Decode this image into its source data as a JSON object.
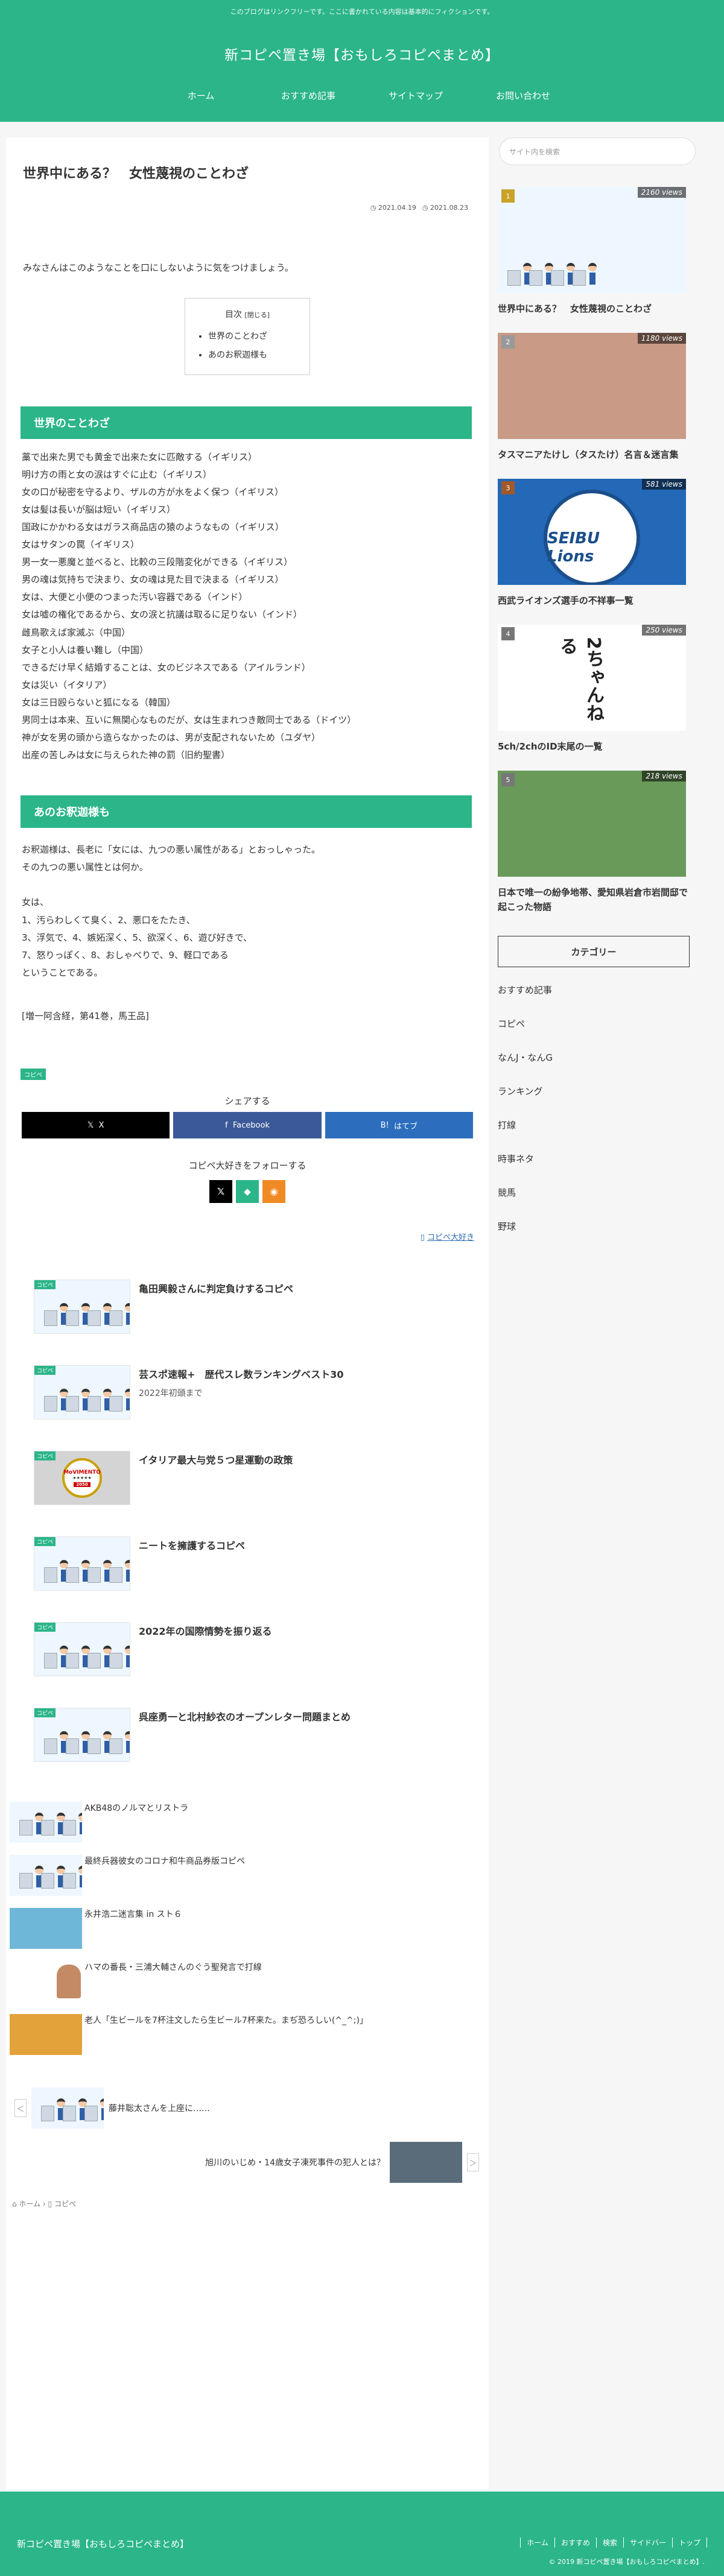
{
  "header": {
    "notice": "このブログはリンクフリーです。ここに書かれている内容は基本的にフィクションです。",
    "site_title": "新コピペ置き場【おもしろコピペまとめ】",
    "nav": [
      "ホーム",
      "おすすめ記事",
      "サイトマップ",
      "お問い合わせ"
    ]
  },
  "article": {
    "title": "世界中にある？　女性蔑視のことわざ",
    "date_posted": "2021.04.19",
    "date_updated": "2021.08.23",
    "lead": "みなさんはこのようなことを口にしないように気をつけましょう。",
    "toc": {
      "title": "目次",
      "close": "[閉じる]",
      "items": [
        "世界のことわざ",
        "あのお釈迦様も"
      ]
    },
    "h2_1": "世界のことわざ",
    "proverbs": [
      "藁で出来た男でも黄金で出来た女に匹敵する（イギリス）",
      "明け方の雨と女の涙はすぐに止む（イギリス）",
      "女の口が秘密を守るより、ザルの方が水をよく保つ（イギリス）",
      "女は髪は長いが脳は短い（イギリス）",
      "国政にかかわる女はガラス商品店の猿のようなもの（イギリス）",
      "女はサタンの罠（イギリス）",
      "男一女一悪魔と並べると、比較の三段階変化ができる（イギリス）",
      "男の魂は気持ちで決まり、女の魂は見た目で決まる（イギリス）",
      "女は、大便と小便のつまった汚い容器である（インド）",
      "女は嘘の権化であるから、女の涙と抗議は取るに足りない（インド）",
      "雌鳥歌えば家滅ぶ（中国）",
      "女子と小人は養い難し（中国）",
      "できるだけ早く結婚することは、女のビジネスである（アイルランド）",
      "女は災い（イタリア）",
      "女は三日殴らないと狐になる（韓国）",
      "男同士は本来、互いに無関心なものだが、女は生まれつき敵同士である（ドイツ）",
      "神が女を男の頭から造らなかったのは、男が支配されないため（ユダヤ）",
      "出産の苦しみは女に与えられた神の罰（旧約聖書）"
    ],
    "h2_2": "あのお釈迦様も",
    "body2": [
      "お釈迦様は、長老に「女には、九つの悪い属性がある」とおっしゃった。",
      "その九つの悪い属性とは何か。",
      "",
      "女は、",
      "1、汚らわしくて臭く、2、悪口をたたき、",
      "3、浮気で、4、嫉妬深く、5、欲深く、6、遊び好きで、",
      "7、怒りっぽく、8、おしゃべりで、9、軽口である",
      "ということである。",
      "",
      "[増一阿含経，第41巻，馬王品]"
    ],
    "category_badge": "コピペ"
  },
  "share": {
    "title": "シェアする",
    "x": "X",
    "facebook": "Facebook",
    "hatena": "はてブ"
  },
  "follow": {
    "title": "コピペ大好きをフォローする",
    "icons": [
      "x-icon",
      "feedly-icon",
      "rss-icon"
    ]
  },
  "author_link": "コピペ大好き",
  "related": [
    {
      "title": "亀田興毅さんに判定負けするコピペ",
      "date": "",
      "tag": "コピペ"
    },
    {
      "title": "芸スポ速報+　歴代スレ数ランキングベスト30",
      "date": "2022年初頭まで",
      "tag": "コピペ"
    },
    {
      "title": "イタリア最大与党５つ星運動の政策",
      "date": "",
      "tag": "コピペ"
    },
    {
      "title": "ニートを擁護するコピペ",
      "date": "",
      "tag": "コピペ"
    },
    {
      "title": "2022年の国際情勢を振り返る",
      "date": "",
      "tag": "コピペ"
    },
    {
      "title": "呉座勇一と北村紗衣のオープンレター問題まとめ",
      "date": "",
      "tag": "コピペ"
    }
  ],
  "movimento": {
    "name": "MoVIMENTO",
    "year": "2050"
  },
  "small_list": [
    "AKB48のノルマとリストラ",
    "最終兵器彼女のコロナ和牛商品券版コピペ",
    "永井浩二迷言集 in スト６",
    "ハマの番長・三浦大輔さんのぐう聖発言で打線",
    "老人「生ビールを7杯注文したら生ビール7杯来た。まぢ恐ろしい(^_^;)」"
  ],
  "pager": {
    "prev": "藤井聡太さんを上座に……",
    "next": "旭川のいじめ・14歳女子凍死事件の犯人とは？",
    "prev_arrow": "＜",
    "next_arrow": "＞"
  },
  "breadcrumb": [
    "ホーム",
    "コピペ"
  ],
  "sidebar": {
    "search_placeholder": "サイト内を検索",
    "popular": [
      {
        "rank": "1",
        "views": "2160 views",
        "title": "世界中にある？　女性蔑視のことわざ",
        "rank_color": "#c9a227"
      },
      {
        "rank": "2",
        "views": "1180 views",
        "title": "タスマニアたけし（タスたけ）名言＆迷言集",
        "rank_color": "#999999"
      },
      {
        "rank": "3",
        "views": "581 views",
        "title": "西武ライオンズ選手の不祥事一覧",
        "rank_color": "#a0592a"
      },
      {
        "rank": "4",
        "views": "250 views",
        "title": "5ch/2chのID末尾の一覧",
        "rank_color": "#777777"
      },
      {
        "rank": "5",
        "views": "218 views",
        "title": "日本で唯一の紛争地帯、愛知県岩倉市岩間邸で起こった物語",
        "rank_color": "#777777"
      }
    ],
    "lions_text": "SEIBU Lions",
    "twoch_text": "2ちゃんねる",
    "category_title": "カテゴリー",
    "categories": [
      "おすすめ記事",
      "コピペ",
      "なんJ・なんG",
      "ランキング",
      "打線",
      "時事ネタ",
      "競馬",
      "野球"
    ]
  },
  "footer": {
    "title": "新コピペ置き場【おもしろコピペまとめ】",
    "nav": [
      "ホーム",
      "おすすめ",
      "検索",
      "サイドバー",
      "トップ"
    ],
    "copyright": "© 2019 新コピペ置き場【おもしろコピペまとめ】."
  },
  "colors": {
    "accent": "#2bb589",
    "link": "#2b6cb0"
  }
}
